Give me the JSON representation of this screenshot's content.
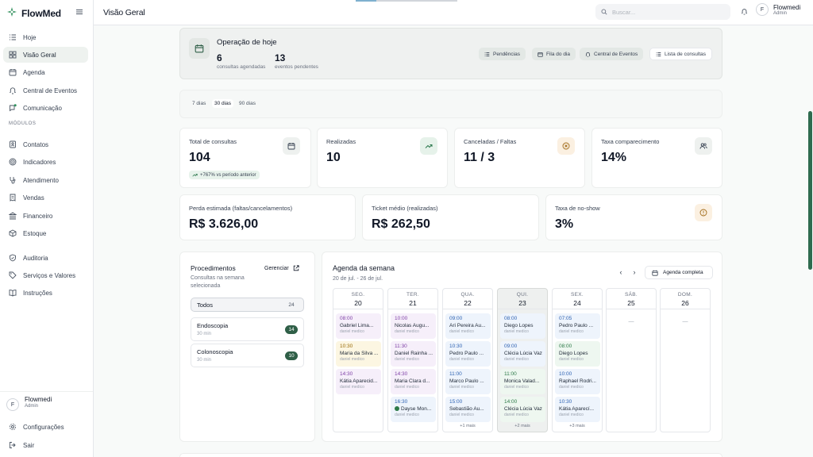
{
  "app": {
    "name": "FlowMed",
    "page_title": "Visão Geral",
    "brand_color": "#2f8f5b",
    "loading_progress": 0.2
  },
  "search": {
    "placeholder": "Buscar..."
  },
  "user": {
    "initial": "F",
    "name": "Flowmedi",
    "role": "Admin"
  },
  "sidebar": {
    "items": [
      {
        "label": "Hoje",
        "icon": "list-icon"
      },
      {
        "label": "Visão Geral",
        "icon": "grid-icon",
        "active": true
      },
      {
        "label": "Agenda",
        "icon": "calendar-icon"
      },
      {
        "label": "Central de Eventos",
        "icon": "bell-icon"
      },
      {
        "label": "Comunicação",
        "icon": "chat-icon"
      }
    ],
    "modules_label": "MÓDULOS",
    "modules": [
      {
        "label": "Contatos",
        "icon": "contacts-icon"
      },
      {
        "label": "Indicadores",
        "icon": "target-icon"
      },
      {
        "label": "Atendimento",
        "icon": "stethoscope-icon"
      },
      {
        "label": "Vendas",
        "icon": "receipt-icon"
      },
      {
        "label": "Financeiro",
        "icon": "bank-icon"
      },
      {
        "label": "Estoque",
        "icon": "box-icon"
      },
      {
        "label": "Auditoria",
        "icon": "shield-icon"
      },
      {
        "label": "Serviços e Valores",
        "icon": "tag-icon"
      },
      {
        "label": "Instruções",
        "icon": "book-icon"
      }
    ],
    "footer": [
      {
        "label": "Configurações",
        "icon": "settings-icon"
      },
      {
        "label": "Sair",
        "icon": "logout-icon"
      }
    ]
  },
  "operation": {
    "title": "Operação de hoje",
    "scheduled_count": "6",
    "scheduled_label": "consultas agendadas",
    "pending_count": "13",
    "pending_label": "eventos pendentes",
    "buttons": [
      "Pendências",
      "Fila do dia",
      "Central de Eventos",
      "Lista de consultas"
    ]
  },
  "periods": {
    "options": [
      "7 dias",
      "30 dias",
      "90 dias"
    ],
    "selected": "30 dias"
  },
  "stats": [
    {
      "label": "Total de consultas",
      "value": "104",
      "icon": "calendar-icon",
      "delta": "+767% vs período anterior"
    },
    {
      "label": "Realizadas",
      "value": "10",
      "icon": "trending-up-icon"
    },
    {
      "label": "Canceladas / Faltas",
      "value": "11 / 3",
      "icon": "x-circle-icon"
    },
    {
      "label": "Taxa comparecimento",
      "value": "14%",
      "icon": "users-icon"
    }
  ],
  "stats2": [
    {
      "label": "Perda estimada (faltas/cancelamentos)",
      "value": "R$ 3.626,00"
    },
    {
      "label": "Ticket médio (realizadas)",
      "value": "R$ 262,50"
    },
    {
      "label": "Taxa de no-show",
      "value": "3%",
      "icon": "alert-circle-icon"
    }
  ],
  "procedures": {
    "title": "Procedimentos",
    "subtitle": "Consultas na semana selecionada",
    "manage": "Gerenciar",
    "items": [
      {
        "name": "Todos",
        "count": "24"
      },
      {
        "name": "Endoscopia",
        "duration": "30 min",
        "count": "14"
      },
      {
        "name": "Colonoscopia",
        "duration": "30 min",
        "count": "10"
      }
    ]
  },
  "agenda": {
    "title": "Agenda da semana",
    "range": "20 de jul. - 26 de jul.",
    "full_button": "Agenda completa",
    "days": [
      {
        "name": "SEG.",
        "num": "20",
        "events": [
          {
            "time": "08:00",
            "name": "Gabriel Lima...",
            "doctor": "daniel medico",
            "color": "purple"
          },
          {
            "time": "10:30",
            "name": "Maria da Silva ...",
            "doctor": "daniel medico",
            "color": "yellow"
          },
          {
            "time": "14:30",
            "name": "Kátia Aparecid...",
            "doctor": "daniel medico",
            "color": "purple"
          }
        ]
      },
      {
        "name": "TER.",
        "num": "21",
        "events": [
          {
            "time": "10:00",
            "name": "Nicolas Augu...",
            "doctor": "daniel medico",
            "color": "purple"
          },
          {
            "time": "11:30",
            "name": "Daniel Rainha ...",
            "doctor": "daniel medico",
            "color": "purple"
          },
          {
            "time": "14:30",
            "name": "Maria Clara d...",
            "doctor": "daniel medico",
            "color": "purple"
          },
          {
            "time": "16:30",
            "name": "Dayse Mon...",
            "doctor": "daniel medico",
            "color": "blue",
            "status_dot": true
          }
        ]
      },
      {
        "name": "QUA.",
        "num": "22",
        "more": "+1 mais",
        "events": [
          {
            "time": "09:00",
            "name": "Ari Pereira Au...",
            "doctor": "daniel medico",
            "color": "blue"
          },
          {
            "time": "10:30",
            "name": "Pedro Paulo ...",
            "doctor": "daniel medico",
            "color": "blue"
          },
          {
            "time": "11:00",
            "name": "Marco Paulo ...",
            "doctor": "daniel medico",
            "color": "blue"
          },
          {
            "time": "15:00",
            "name": "Sebastião Au...",
            "doctor": "daniel medico",
            "color": "blue"
          }
        ]
      },
      {
        "name": "QUI.",
        "num": "23",
        "today": true,
        "more": "+2 mais",
        "events": [
          {
            "time": "08:00",
            "name": "Diego Lopes",
            "doctor": "daniel medico",
            "color": "blue"
          },
          {
            "time": "09:00",
            "name": "Clécia Lúcia Vaz",
            "doctor": "daniel medico",
            "color": "blue"
          },
          {
            "time": "11:00",
            "name": "Monica Valad...",
            "doctor": "daniel medico",
            "color": "green"
          },
          {
            "time": "14:00",
            "name": "Clécia Lúcia Vaz",
            "doctor": "daniel medico",
            "color": "green"
          }
        ]
      },
      {
        "name": "SEX.",
        "num": "24",
        "more": "+3 mais",
        "events": [
          {
            "time": "07:05",
            "name": "Pedro Paulo ...",
            "doctor": "daniel medico",
            "color": "blue"
          },
          {
            "time": "08:00",
            "name": "Diego Lopes",
            "doctor": "daniel medico",
            "color": "green"
          },
          {
            "time": "10:00",
            "name": "Raphael Rodri...",
            "doctor": "daniel medico",
            "color": "blue"
          },
          {
            "time": "10:30",
            "name": "Kátia Aparecí...",
            "doctor": "daniel medico",
            "color": "blue"
          }
        ]
      },
      {
        "name": "SÁB.",
        "num": "25",
        "empty": "—",
        "events": []
      },
      {
        "name": "DOM.",
        "num": "26",
        "empty": "—",
        "events": []
      }
    ]
  }
}
